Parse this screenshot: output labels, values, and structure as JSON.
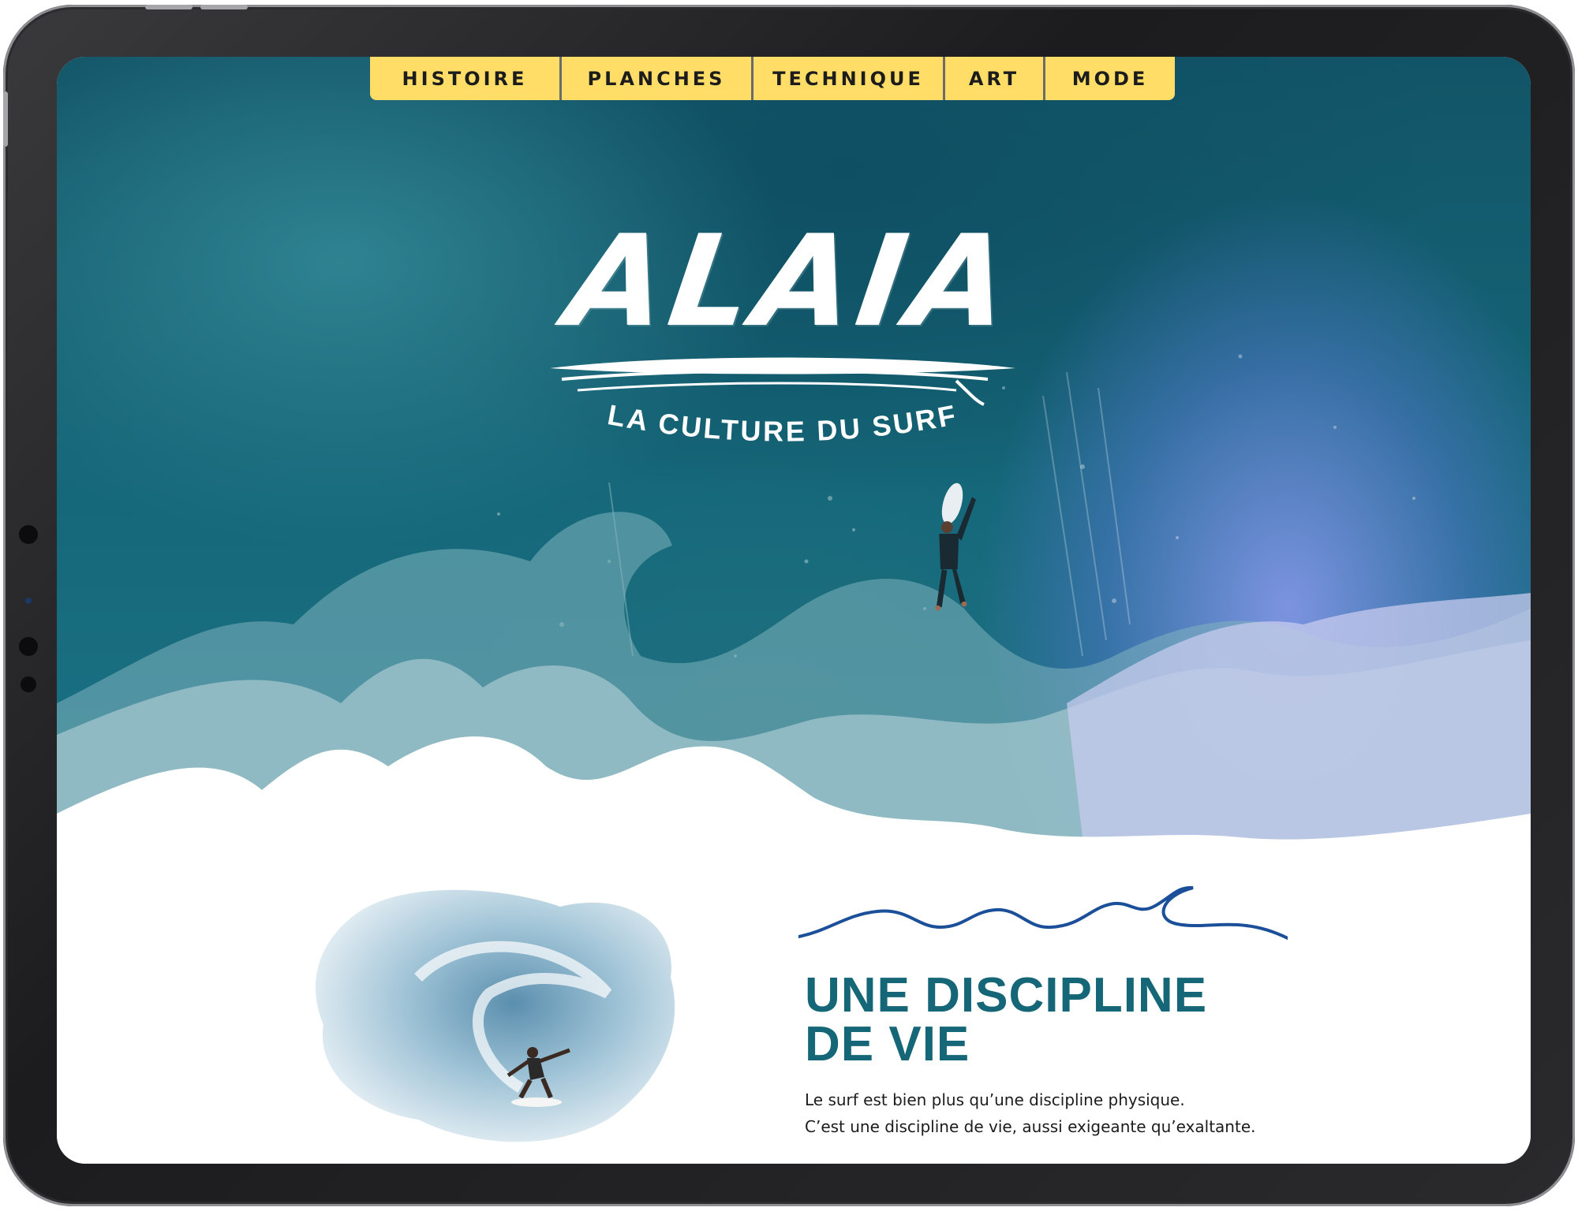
{
  "nav": {
    "items": [
      {
        "label": "HISTOIRE"
      },
      {
        "label": "PLANCHES"
      },
      {
        "label": "TECHNIQUE"
      },
      {
        "label": "ART"
      },
      {
        "label": "MODE"
      }
    ]
  },
  "hero": {
    "logo_text": "ALAIA",
    "tagline": "LA CULTURE DU SURF"
  },
  "section": {
    "title_line1": "UNE DISCIPLINE",
    "title_line2": "DE VIE",
    "body_line1": "Le surf est bien plus qu’une discipline physique.",
    "body_line2": "C’est une discipline de vie, aussi exigeante qu’exaltante."
  },
  "colors": {
    "nav_bg": "#ffdd66",
    "headline": "#156676",
    "squiggle": "#1b4f9a",
    "ocean": "#125467"
  }
}
